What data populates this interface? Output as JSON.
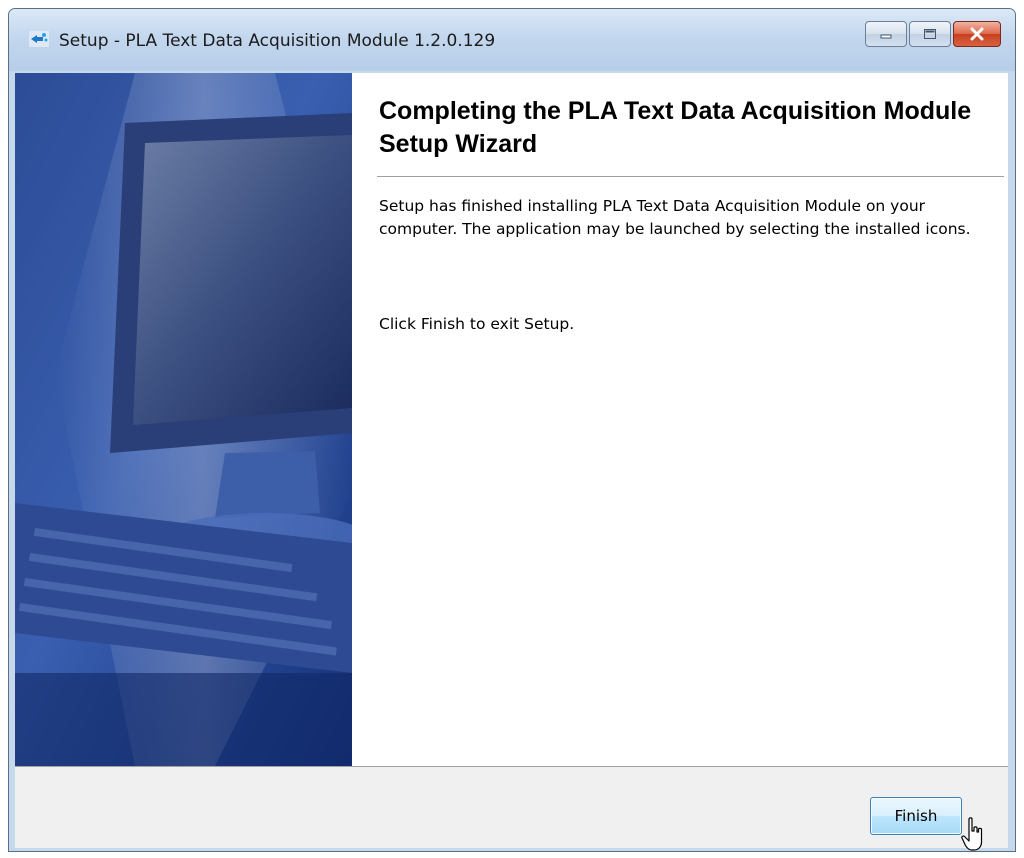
{
  "window": {
    "title": "Setup - PLA Text Data Acquisition Module 1.2.0.129"
  },
  "caption_buttons": {
    "minimize_icon": "minimize-icon",
    "maximize_icon": "maximize-icon",
    "close_icon": "close-icon"
  },
  "wizard": {
    "heading": "Completing the PLA Text Data Acquisition Module Setup Wizard",
    "message": "Setup has finished installing PLA Text Data Acquisition Module on your computer. The application may be launched by selecting the installed icons.",
    "instruction": "Click Finish to exit Setup."
  },
  "footer": {
    "finish_label": "Finish"
  },
  "colors": {
    "titlebar": "#c3d7ee",
    "side_image_blue": "#1e3f86",
    "button_accent": "#3c7fb1",
    "close_button": "#c83f22"
  }
}
